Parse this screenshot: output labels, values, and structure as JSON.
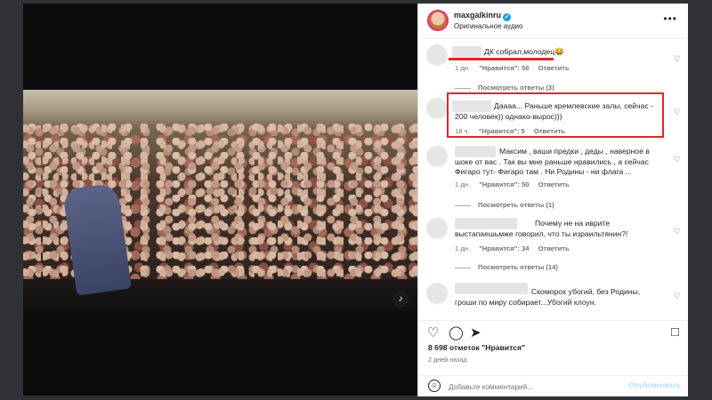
{
  "post": {
    "username": "maxgalkinru",
    "audio": "Оригинальное аудио"
  },
  "comments": [
    {
      "text": "ДК собрал,молодец😂",
      "time": "1 дн.",
      "likes": "\"Нравится\": 56",
      "reply": "Ответить",
      "view_replies": "Посмотреть ответы (3)"
    },
    {
      "text": "Даааа... Раньше кремлевские залы, сейчас - 200 человек)) однако-вырос)))",
      "time": "18 ч.",
      "likes": "\"Нравится\": 5",
      "reply": "Ответить"
    },
    {
      "text": "Максим , ваши предки , деды , наверное в шоке от вас . Так вы мне раньше нравились , а сейчас Фигаро тут- Фигаро там . Ни Родины - ни флага ...",
      "time": "1 дн.",
      "likes": "\"Нравится\": 50",
      "reply": "Ответить",
      "view_replies": "Посмотреть ответы (1)"
    },
    {
      "text": "Почему не на иврите выстапаешьмже говорил, что ты израильтянин?!",
      "time": "1 дн.",
      "likes": "\"Нравится\": 34",
      "reply": "Ответить",
      "view_replies": "Посмотреть ответы (14)"
    },
    {
      "text": "Скоморох убогий, без Родины, гроши по миру собирает...Убогий клоун."
    }
  ],
  "footer": {
    "likes_count": "8 698 отметок \"Нравится\"",
    "date": "2 дней назад",
    "comment_placeholder": "Добавьте комментарий...",
    "publish": "Опубликовать"
  },
  "icons": {
    "verified": "verified-badge-icon",
    "more": "more-horizontal-icon",
    "heart": "heart-icon",
    "comment": "comment-icon",
    "share": "send-icon",
    "save": "bookmark-icon",
    "emoji": "emoji-icon",
    "sound": "speaker-icon"
  },
  "colors": {
    "highlight": "#e0262a",
    "verified": "#1d9bf0",
    "publish_disabled": "#b2dffc"
  }
}
